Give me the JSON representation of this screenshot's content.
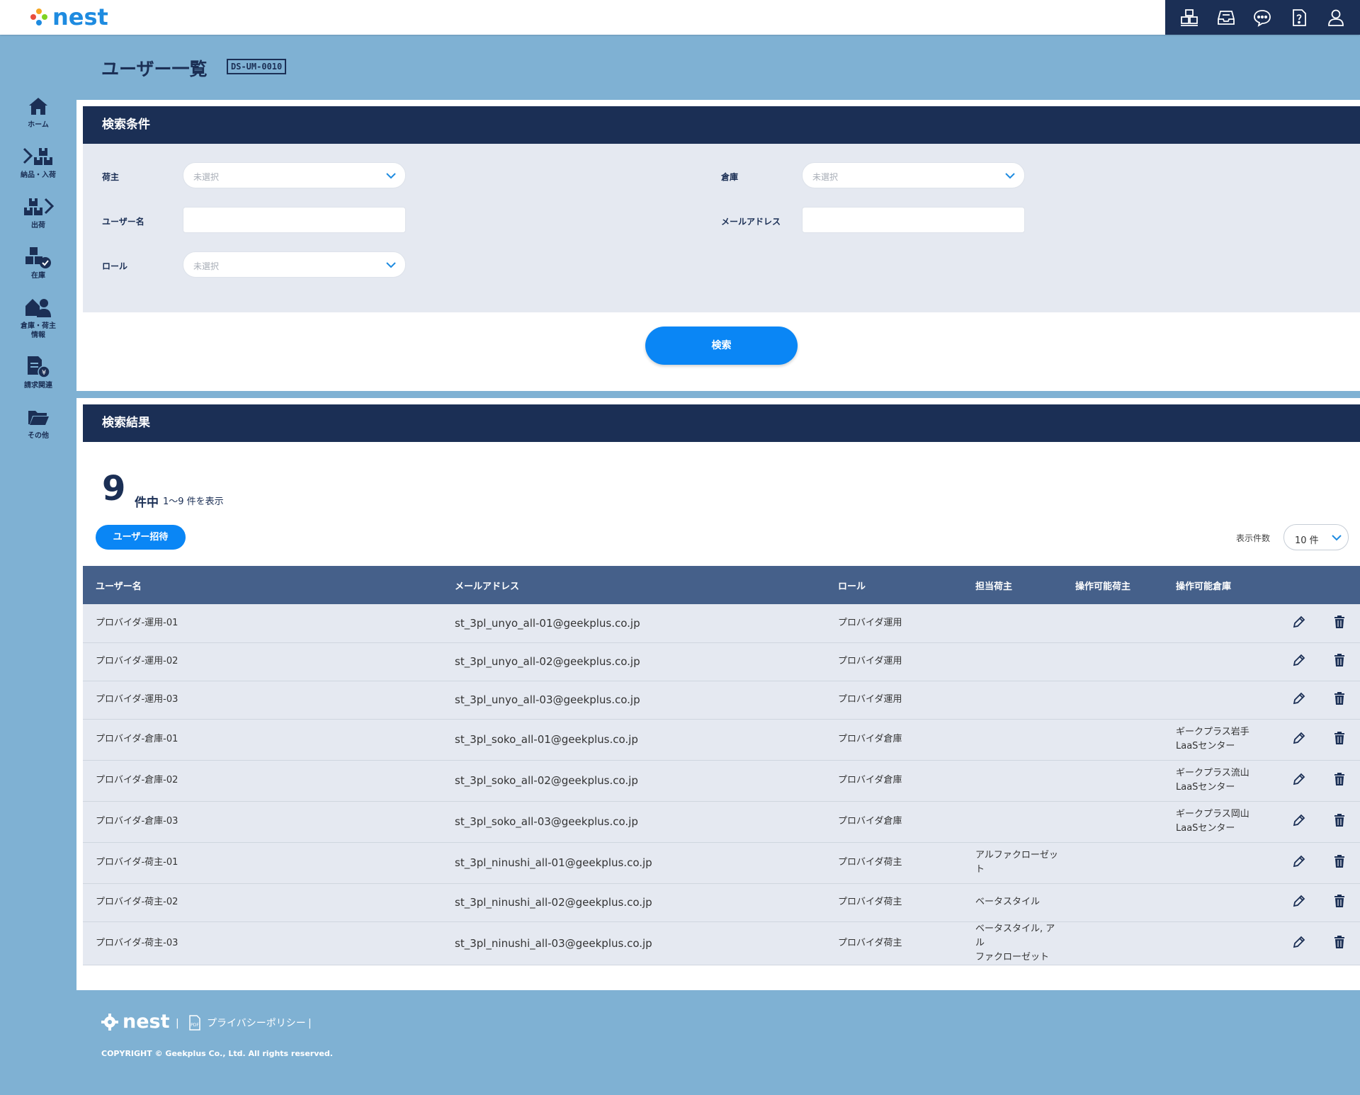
{
  "app": {
    "logo_text": "nest"
  },
  "header": {
    "icons": [
      "warehouse-icon",
      "inbox-icon",
      "chat-icon",
      "help-icon",
      "user-icon"
    ]
  },
  "sidebar": {
    "items": [
      {
        "label": "ホーム",
        "icon": "home-icon"
      },
      {
        "label": "納品・入荷",
        "icon": "inbound-icon"
      },
      {
        "label": "出荷",
        "icon": "outbound-icon"
      },
      {
        "label": "在庫",
        "icon": "inventory-icon"
      },
      {
        "label": "倉庫・荷主\n情報",
        "icon": "warehouse-owner-icon"
      },
      {
        "label": "請求関連",
        "icon": "billing-icon"
      },
      {
        "label": "その他",
        "icon": "folder-icon"
      }
    ]
  },
  "page": {
    "title": "ユーザー一覧",
    "screen_id": "DS-UM-0010"
  },
  "search": {
    "heading": "検索条件",
    "shipper_label": "荷主",
    "shipper_placeholder": "未選択",
    "warehouse_label": "倉庫",
    "warehouse_placeholder": "未選択",
    "username_label": "ユーザー名",
    "email_label": "メールアドレス",
    "role_label": "ロール",
    "role_placeholder": "未選択",
    "button": "検索"
  },
  "results": {
    "heading": "検索結果",
    "total": "9",
    "total_suffix": "件中",
    "range": "1～9 件を表示",
    "invite_button": "ユーザー招待",
    "per_page_label": "表示件数",
    "per_page_value": "10 件",
    "columns": [
      "ユーザー名",
      "メールアドレス",
      "ロール",
      "担当荷主",
      "操作可能荷主",
      "操作可能倉庫"
    ],
    "rows": [
      {
        "username": "プロバイダ-運用-01",
        "email": "st_3pl_unyo_all-01@geekplus.co.jp",
        "role": "プロバイダ運用",
        "assigned_shipper": "",
        "operable_shipper": "",
        "operable_warehouse": ""
      },
      {
        "username": "プロバイダ-運用-02",
        "email": "st_3pl_unyo_all-02@geekplus.co.jp",
        "role": "プロバイダ運用",
        "assigned_shipper": "",
        "operable_shipper": "",
        "operable_warehouse": ""
      },
      {
        "username": "プロバイダ-運用-03",
        "email": "st_3pl_unyo_all-03@geekplus.co.jp",
        "role": "プロバイダ運用",
        "assigned_shipper": "",
        "operable_shipper": "",
        "operable_warehouse": ""
      },
      {
        "username": "プロバイダ-倉庫-01",
        "email": "st_3pl_soko_all-01@geekplus.co.jp",
        "role": "プロバイダ倉庫",
        "assigned_shipper": "",
        "operable_shipper": "",
        "operable_warehouse": "ギークプラス岩手\nLaaSセンター"
      },
      {
        "username": "プロバイダ-倉庫-02",
        "email": "st_3pl_soko_all-02@geekplus.co.jp",
        "role": "プロバイダ倉庫",
        "assigned_shipper": "",
        "operable_shipper": "",
        "operable_warehouse": "ギークプラス流山\nLaaSセンター"
      },
      {
        "username": "プロバイダ-倉庫-03",
        "email": "st_3pl_soko_all-03@geekplus.co.jp",
        "role": "プロバイダ倉庫",
        "assigned_shipper": "",
        "operable_shipper": "",
        "operable_warehouse": "ギークプラス岡山\nLaaSセンター"
      },
      {
        "username": "プロバイダ-荷主-01",
        "email": "st_3pl_ninushi_all-01@geekplus.co.jp",
        "role": "プロバイダ荷主",
        "assigned_shipper": "アルファクローゼッ\nト",
        "operable_shipper": "",
        "operable_warehouse": ""
      },
      {
        "username": "プロバイダ-荷主-02",
        "email": "st_3pl_ninushi_all-02@geekplus.co.jp",
        "role": "プロバイダ荷主",
        "assigned_shipper": "ベータスタイル",
        "operable_shipper": "",
        "operable_warehouse": ""
      },
      {
        "username": "プロバイダ-荷主-03",
        "email": "st_3pl_ninushi_all-03@geekplus.co.jp",
        "role": "プロバイダ荷主",
        "assigned_shipper": "ベータスタイル, アル\nファクローゼット",
        "operable_shipper": "",
        "operable_warehouse": ""
      }
    ]
  },
  "footer": {
    "logo_text": "nest",
    "privacy_link": "プライバシーポリシー",
    "copyright": "COPYRIGHT © Geekplus Co., Ltd. All rights reserved."
  },
  "colors": {
    "navy": "#1b2f55",
    "accent": "#0a86f5",
    "background": "#7fb1d3",
    "table_header": "#45608a"
  }
}
